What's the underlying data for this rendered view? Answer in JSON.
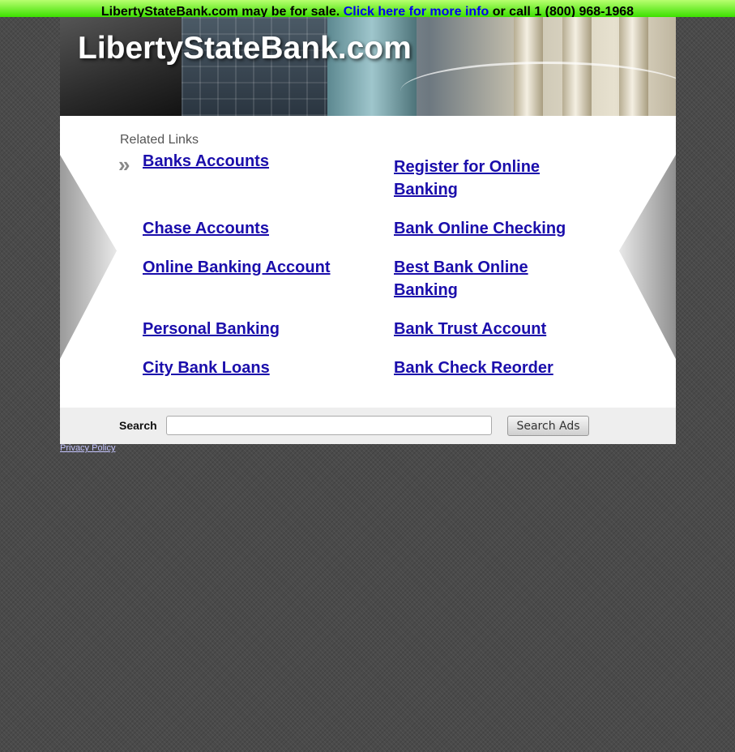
{
  "topbar": {
    "message": "LibertyStateBank.com may be for sale.",
    "link_text": "Click here for more info",
    "phone_text": "or call 1 (800) 968-1968"
  },
  "header": {
    "site_title": "LibertyStateBank.com"
  },
  "related": {
    "heading": "Related Links",
    "links": [
      "Banks Accounts",
      "Register for Online Banking",
      "Chase Accounts",
      "Bank Online Checking",
      "Online Banking Account",
      "Best Bank Online Banking",
      "Personal Banking",
      "Bank Trust Account",
      "City Bank Loans",
      "Bank Check Reorder"
    ]
  },
  "search": {
    "label": "Search",
    "button_label": "Search Ads",
    "value": ""
  },
  "footer": {
    "privacy_label": "Privacy Policy"
  },
  "colors": {
    "link": "#1a0dab",
    "topbar_green": "#3ce000"
  }
}
